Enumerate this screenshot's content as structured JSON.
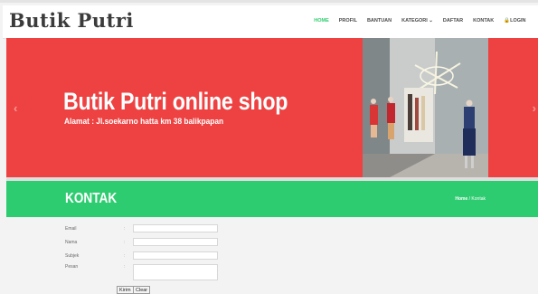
{
  "header": {
    "logo": "Butik Putri",
    "nav": [
      {
        "label": "HOME",
        "active": true
      },
      {
        "label": "PROFIL",
        "active": false
      },
      {
        "label": "BANTUAN",
        "active": false
      },
      {
        "label": "KATEGORI ⌄",
        "active": false
      },
      {
        "label": "DAFTAR",
        "active": false
      },
      {
        "label": "KONTAK",
        "active": false
      },
      {
        "label": "🔒LOGIN",
        "active": false
      }
    ]
  },
  "hero": {
    "title": "Butik Putri online shop",
    "subtitle": "Alamat : Jl.soekarno hatta km 38 balikpapan",
    "prev_arrow": "‹",
    "next_arrow": "›"
  },
  "section": {
    "title": "KONTAK",
    "breadcrumb_home": "Home",
    "breadcrumb_sep": "/",
    "breadcrumb_current": "Kontak"
  },
  "form": {
    "fields": [
      {
        "label": "Email",
        "colon": ":",
        "value": ""
      },
      {
        "label": "Nama",
        "colon": ":",
        "value": ""
      },
      {
        "label": "Subjek",
        "colon": ":",
        "value": ""
      },
      {
        "label": "Pesan",
        "colon": ":",
        "value": ""
      }
    ],
    "submit_label": "Kirim",
    "reset_label": "Clear"
  },
  "colors": {
    "hero_bg": "#ee4242",
    "section_bg": "#2ecc71",
    "nav_active": "#2fcc6e"
  }
}
